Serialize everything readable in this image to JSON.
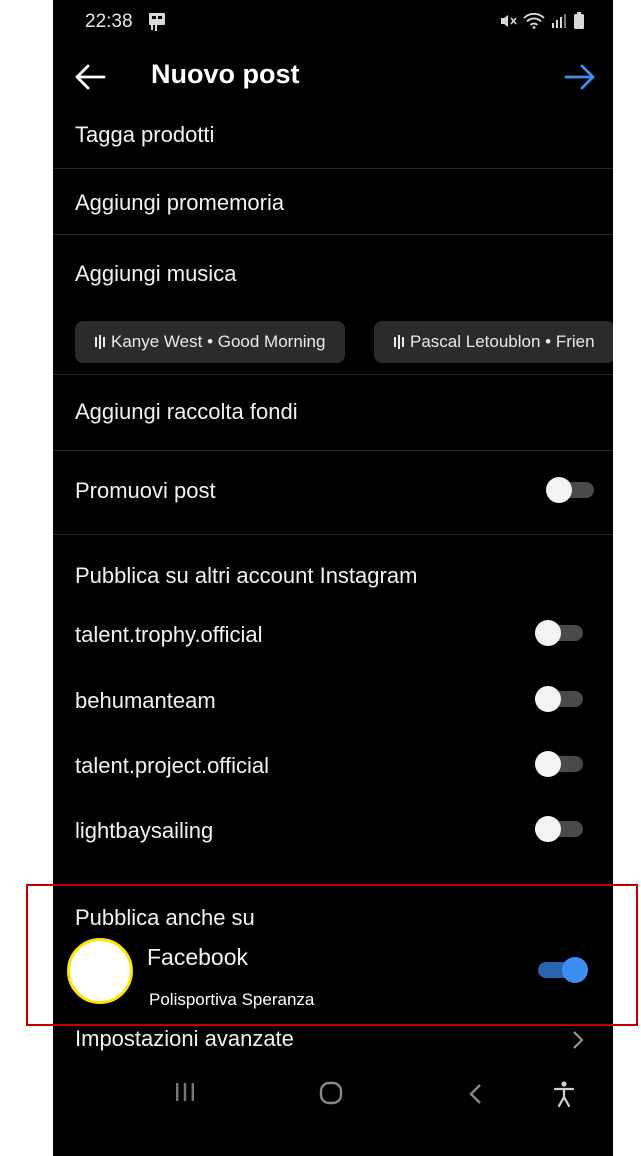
{
  "status_bar": {
    "time": "22:38"
  },
  "header": {
    "title": "Nuovo post",
    "back_icon": "arrow-left-icon",
    "next_icon": "arrow-right-icon",
    "accent_color": "#3b8ff0"
  },
  "menu": {
    "tag_products": "Tagga prodotti",
    "add_reminder": "Aggiungi promemoria",
    "add_music": "Aggiungi musica",
    "add_fundraiser": "Aggiungi raccolta fondi",
    "promote_post": "Promuovi post",
    "promote_post_on": false
  },
  "music_suggestions": [
    "Kanye West • Good Morning",
    "Pascal Letoublon • Frien"
  ],
  "other_accounts": {
    "heading": "Pubblica su altri account Instagram",
    "accounts": [
      {
        "name": "talent.trophy.official",
        "on": false
      },
      {
        "name": "behumanteam",
        "on": false
      },
      {
        "name": "talent.project.official",
        "on": false
      },
      {
        "name": "lightbaysailing",
        "on": false
      }
    ]
  },
  "also_publish": {
    "heading": "Pubblica anche su",
    "platform": "Facebook",
    "page_name": "Polisportiva Speranza",
    "on": true
  },
  "advanced": {
    "label": "Impostazioni avanzate"
  },
  "highlight_color": "#c00000"
}
